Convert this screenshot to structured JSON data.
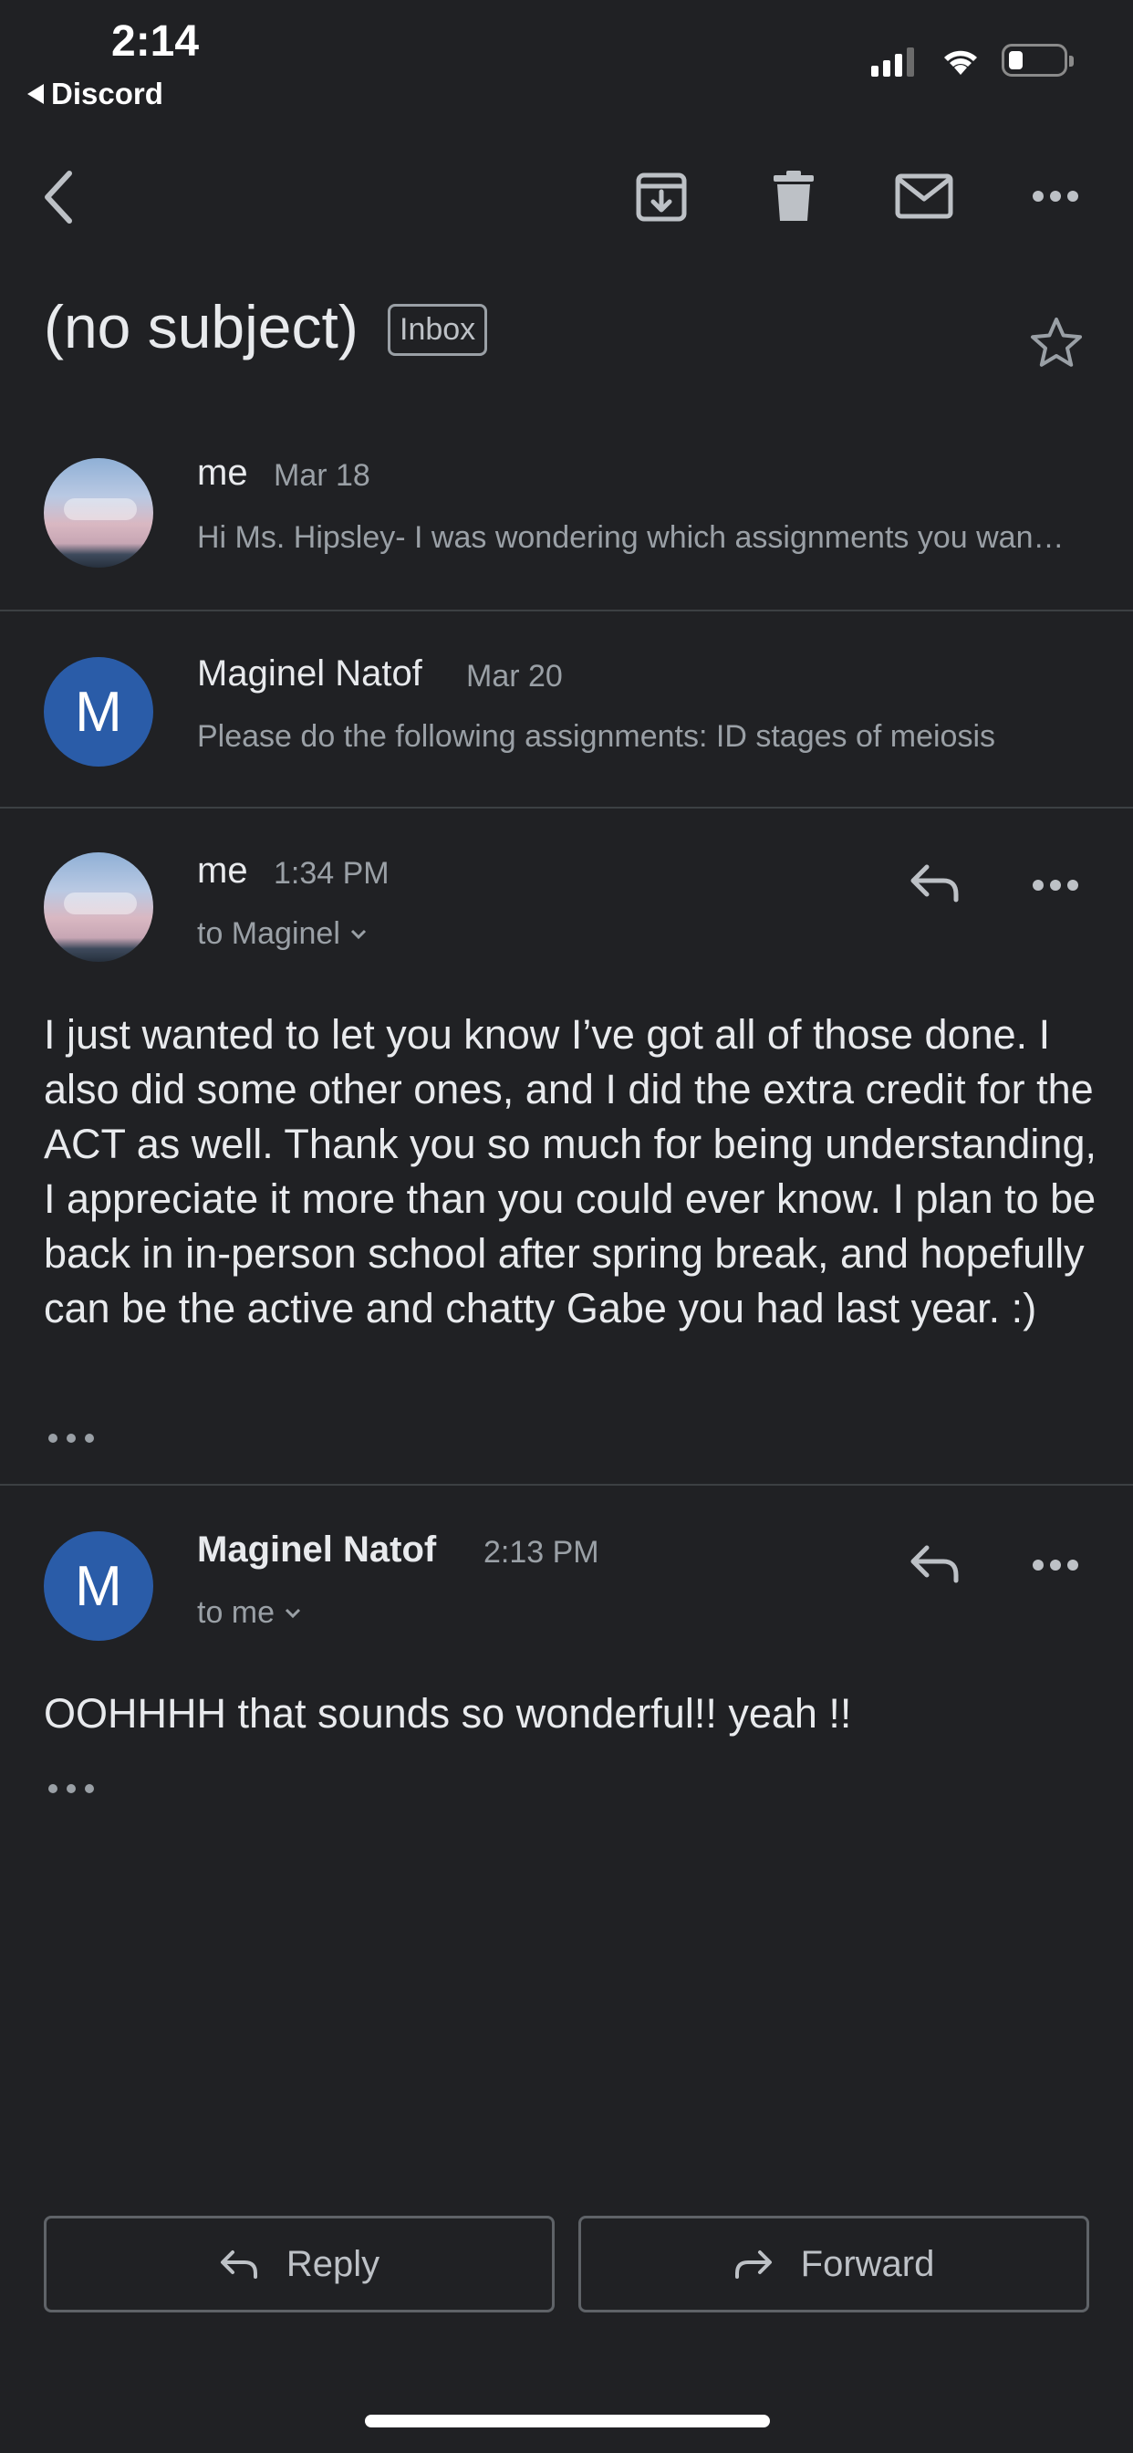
{
  "status_bar": {
    "time": "2:14",
    "back_app": "Discord"
  },
  "toolbar": {
    "icons": [
      "back-arrow-icon",
      "archive-icon",
      "trash-icon",
      "mail-icon",
      "more-icon"
    ]
  },
  "email": {
    "subject": "(no subject)",
    "label": "Inbox"
  },
  "messages": [
    {
      "sender": "me",
      "date": "Mar 18",
      "snippet": "Hi Ms. Hipsley- I was wondering which assignments you wanted me to do",
      "avatar_letter": ""
    },
    {
      "sender": "Maginel Natof",
      "date": "Mar 20",
      "snippet": "Please do the following assignments: ID stages of meiosis",
      "avatar_letter": "M"
    },
    {
      "sender": "me",
      "time": "1:34 PM",
      "to": "to Maginel",
      "body": "I just wanted to let you know I’ve got all of those done. I also did some other ones, and I did the extra credit for the ACT as well. Thank you so much for being understanding, I appreciate it more than you could ever know. I plan to be back in in-person school after spring break, and hopefully can be the active and chatty Gabe you had last year. :)"
    },
    {
      "sender": "Maginel Natof",
      "time": "2:13 PM",
      "to": "to me",
      "body": "OOHHHH that sounds so wonderful!! yeah !!",
      "avatar_letter": "M"
    }
  ],
  "actions": {
    "reply": "Reply",
    "forward": "Forward"
  },
  "colors": {
    "background": "#202124",
    "avatar_blue": "#2a5ca8"
  }
}
